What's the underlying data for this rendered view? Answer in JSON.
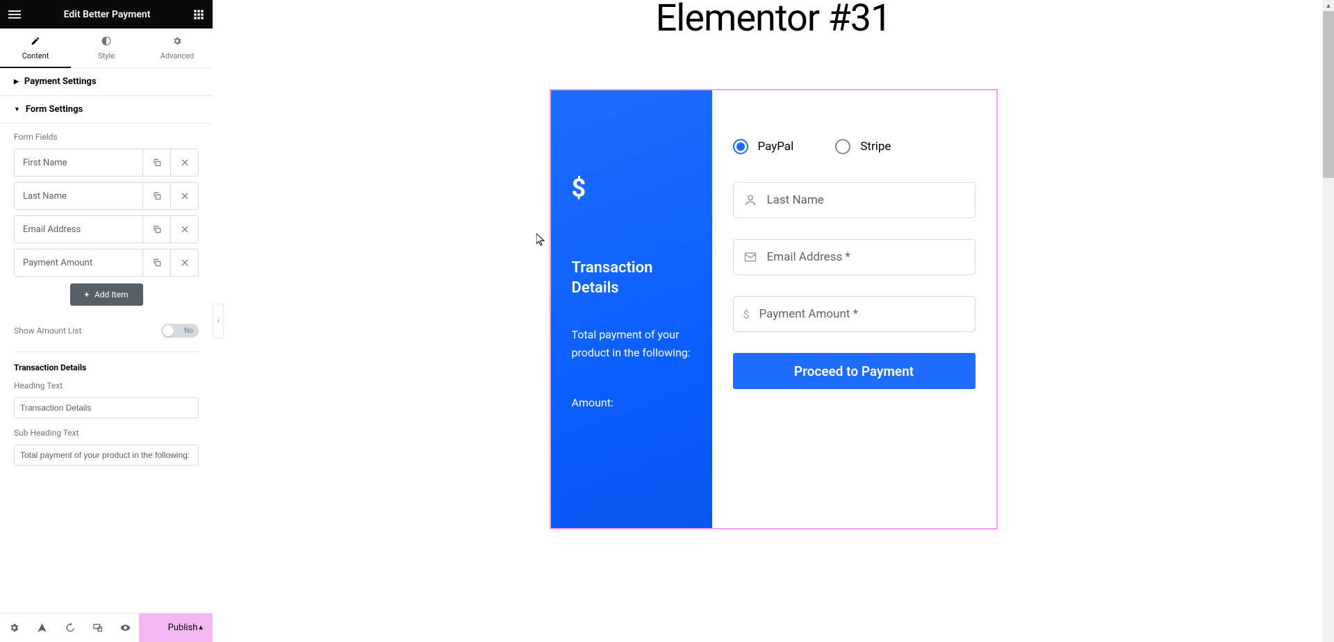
{
  "header": {
    "title": "Edit Better Payment"
  },
  "tabs": {
    "content": "Content",
    "style": "Style",
    "advanced": "Advanced"
  },
  "sections": {
    "payment_settings": "Payment Settings",
    "form_settings": "Form Settings"
  },
  "form_fields_label": "Form Fields",
  "form_fields": [
    {
      "label": "First Name"
    },
    {
      "label": "Last Name"
    },
    {
      "label": "Email Address"
    },
    {
      "label": "Payment Amount"
    }
  ],
  "add_item": "Add Item",
  "show_amount_list": {
    "label": "Show Amount List",
    "value": "No"
  },
  "transaction_details": {
    "title": "Transaction Details",
    "heading_label": "Heading Text",
    "heading_value": "Transaction Details",
    "sub_label": "Sub Heading Text",
    "sub_value": "Total payment of your product in the following:"
  },
  "footer": {
    "publish": "Publish"
  },
  "preview": {
    "page_title": "Elementor #31",
    "radio_paypal": "PayPal",
    "radio_stripe": "Stripe",
    "field_lastname": "Last Name",
    "field_email": "Email Address *",
    "field_amount": "Payment Amount *",
    "proceed": "Proceed to Payment",
    "td_title": "Transaction Details",
    "td_sub": "Total payment of your product in the following:",
    "td_amount": "Amount:"
  }
}
